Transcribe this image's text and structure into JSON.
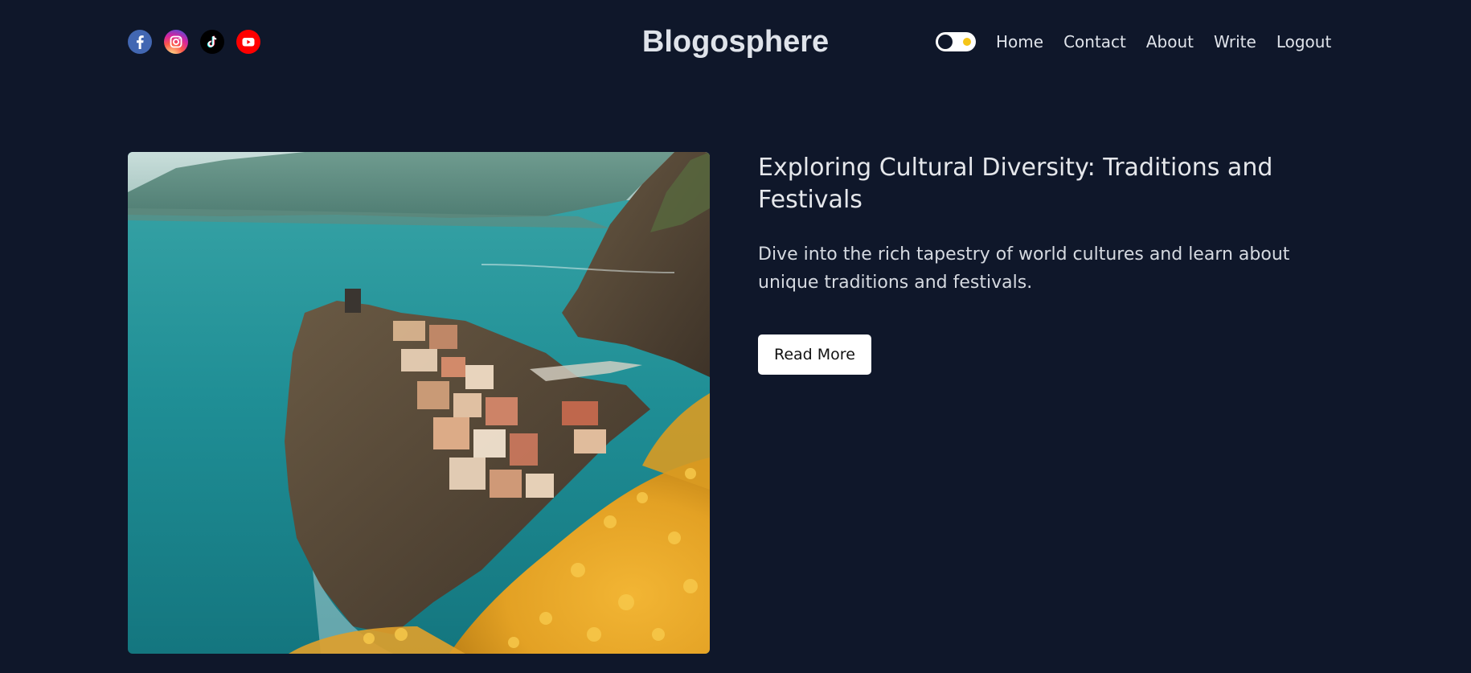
{
  "brand": {
    "title": "Blogosphere"
  },
  "socials": [
    {
      "name": "facebook-icon",
      "color": "#4267b2"
    },
    {
      "name": "instagram-icon",
      "color": "#d6249f"
    },
    {
      "name": "tiktok-icon",
      "color": "#000000"
    },
    {
      "name": "youtube-icon",
      "color": "#ff0000"
    }
  ],
  "theme_toggle": {
    "state": "dark",
    "knob_color": "#0f172a",
    "sun_color": "#f5c518"
  },
  "nav": {
    "home": "Home",
    "contact": "Contact",
    "about": "About",
    "write": "Write",
    "logout": "Logout"
  },
  "post": {
    "title": "Exploring Cultural Diversity: Traditions and Festivals",
    "description": "Dive into the rich tapestry of world cultures and learn about unique traditions and festivals.",
    "read_more_label": "Read More"
  },
  "colors": {
    "background": "#0f172a",
    "text": "#e2e8f0",
    "button_bg": "#ffffff",
    "button_text": "#111111"
  }
}
